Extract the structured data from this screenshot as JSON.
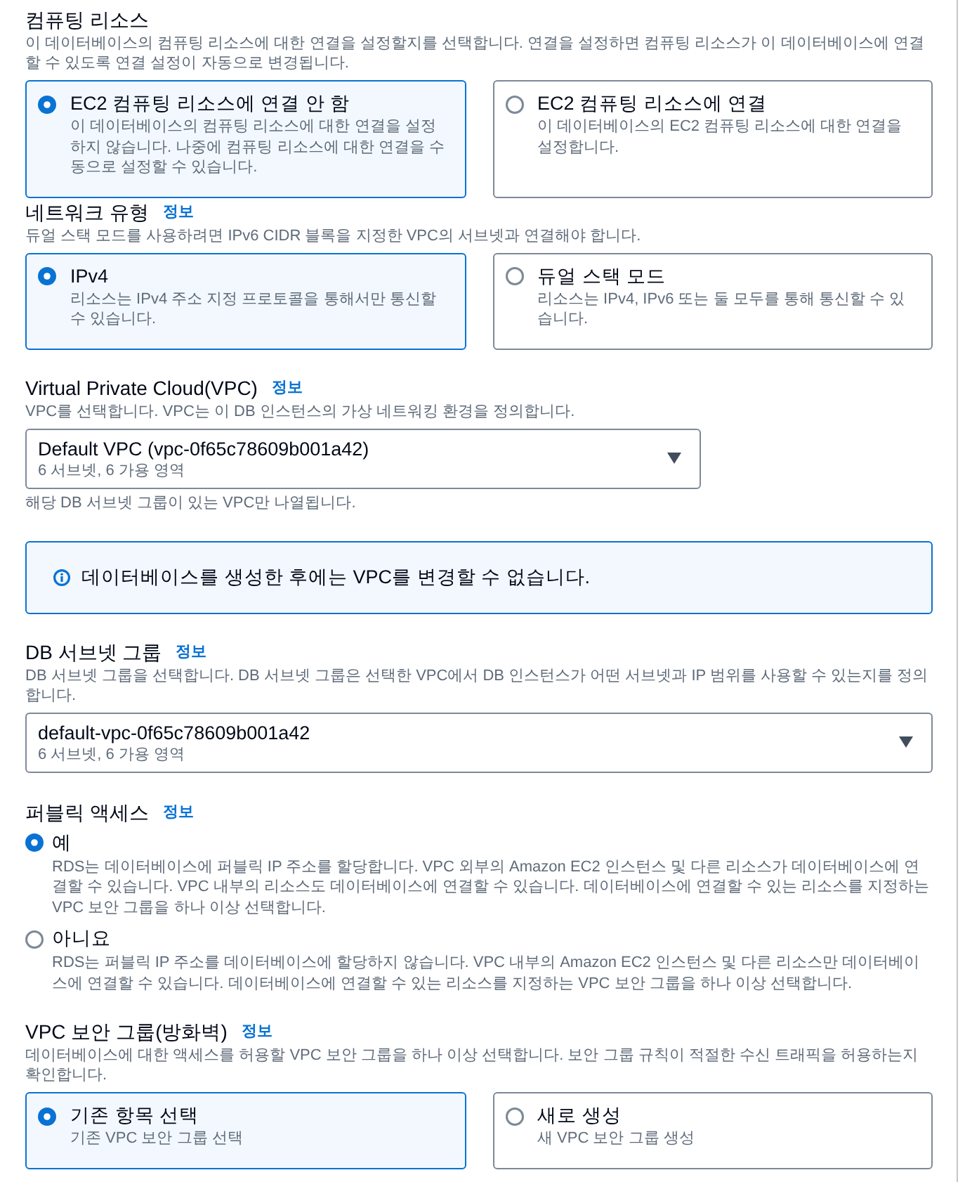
{
  "sections": [
    {
      "kind": "tiles",
      "title": "컴퓨팅 리소스",
      "description": "이 데이터베이스의 컴퓨팅 리소스에 대한 연결을 설정할지를 선택합니다. 연결을 설정하면 컴퓨팅 리소스가 이 데이터베이스에 연결할 수 있도록 연결 설정이 자동으로 변경됩니다.",
      "options": [
        {
          "label": "EC2 컴퓨팅 리소스에 연결 안 함",
          "description": "이 데이터베이스의 컴퓨팅 리소스에 대한 연결을 설정하지 않습니다. 나중에 컴퓨팅 리소스에 대한 연결을 수동으로 설정할 수 있습니다.",
          "selected": true
        },
        {
          "label": "EC2 컴퓨팅 리소스에 연결",
          "description": "이 데이터베이스의 EC2 컴퓨팅 리소스에 대한 연결을 설정합니다.",
          "selected": false
        }
      ]
    },
    {
      "kind": "tiles",
      "title": "네트워크 유형",
      "info": "정보",
      "description": "듀얼 스택 모드를 사용하려면 IPv6 CIDR 블록을 지정한 VPC의 서브넷과 연결해야 합니다.",
      "options": [
        {
          "label": "IPv4",
          "description": "리소스는 IPv4 주소 지정 프로토콜을 통해서만 통신할 수 있습니다.",
          "selected": true
        },
        {
          "label": "듀얼 스택 모드",
          "description": "리소스는 IPv4, IPv6 또는 둘 모두를 통해 통신할 수 있습니다.",
          "selected": false
        }
      ]
    },
    {
      "kind": "select",
      "title": "Virtual Private Cloud(VPC)",
      "info": "정보",
      "description": "VPC를 선택합니다. VPC는 이 DB 인스턴스의 가상 네트워킹 환경을 정의합니다.",
      "select": {
        "value": "Default VPC (vpc-0f65c78609b001a42)",
        "detail": "6 서브넷, 6 가용 영역"
      },
      "hint": "해당 DB 서브넷 그룹이 있는 VPC만 나열됩니다."
    },
    {
      "kind": "alert",
      "text": "데이터베이스를 생성한 후에는 VPC를 변경할 수 없습니다."
    },
    {
      "kind": "select",
      "title": "DB 서브넷 그룹",
      "info": "정보",
      "description": "DB 서브넷 그룹을 선택합니다. DB 서브넷 그룹은 선택한 VPC에서 DB 인스턴스가 어떤 서브넷과 IP 범위를 사용할 수 있는지를 정의합니다.",
      "select": {
        "value": "default-vpc-0f65c78609b001a42",
        "detail": "6 서브넷, 6 가용 영역"
      }
    },
    {
      "kind": "radios",
      "title": "퍼블릭 액세스",
      "info": "정보",
      "options": [
        {
          "label": "예",
          "description": "RDS는 데이터베이스에 퍼블릭 IP 주소를 할당합니다. VPC 외부의 Amazon EC2 인스턴스 및 다른 리소스가 데이터베이스에 연결할 수 있습니다. VPC 내부의 리소스도 데이터베이스에 연결할 수 있습니다. 데이터베이스에 연결할 수 있는 리소스를 지정하는 VPC 보안 그룹을 하나 이상 선택합니다.",
          "selected": true
        },
        {
          "label": "아니요",
          "description": "RDS는 퍼블릭 IP 주소를 데이터베이스에 할당하지 않습니다. VPC 내부의 Amazon EC2 인스턴스 및 다른 리소스만 데이터베이스에 연결할 수 있습니다. 데이터베이스에 연결할 수 있는 리소스를 지정하는 VPC 보안 그룹을 하나 이상 선택합니다.",
          "selected": false
        }
      ]
    },
    {
      "kind": "tiles",
      "title": "VPC 보안 그룹(방화벽)",
      "info": "정보",
      "description": "데이터베이스에 대한 액세스를 허용할 VPC 보안 그룹을 하나 이상 선택합니다. 보안 그룹 규칙이 적절한 수신 트래픽을 허용하는지 확인합니다.",
      "options": [
        {
          "label": "기존 항목 선택",
          "description": "기존 VPC 보안 그룹 선택",
          "selected": true
        },
        {
          "label": "새로 생성",
          "description": "새 VPC 보안 그룹 생성",
          "selected": false
        }
      ]
    }
  ]
}
